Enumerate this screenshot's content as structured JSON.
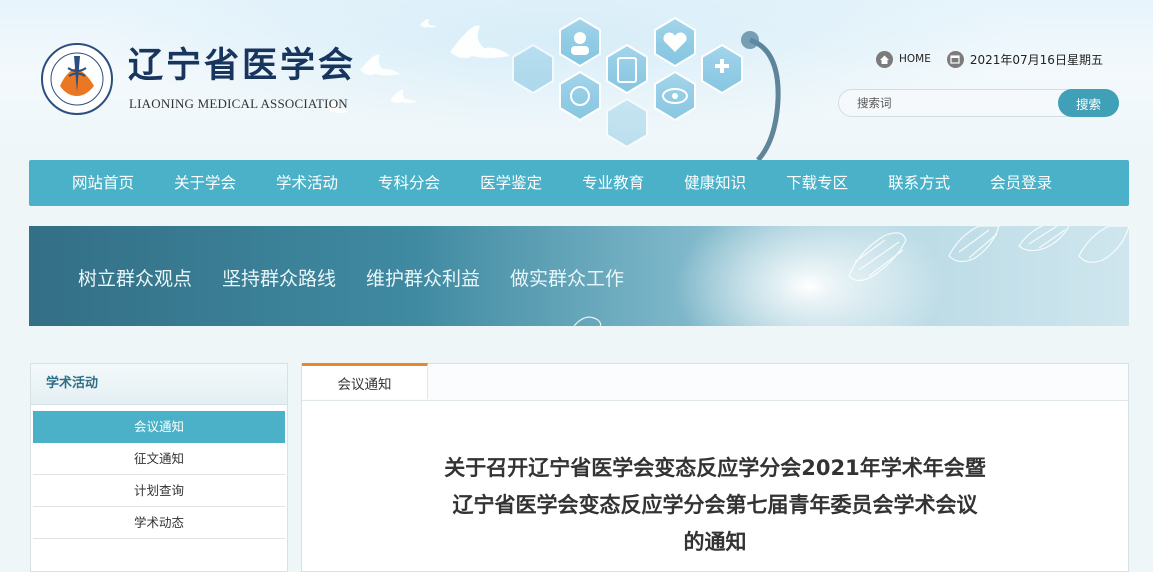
{
  "header": {
    "logo_cn": "辽宁省医学会",
    "logo_en": "LIAONING MEDICAL ASSOCIATION",
    "logo_icon": "liaoning-medical-association-seal",
    "home_label": "HOME",
    "home_icon": "home-icon",
    "date_icon": "calendar-icon",
    "date": "2021年07月16日星期五",
    "search": {
      "placeholder": "搜索词",
      "button_label": "搜索"
    }
  },
  "nav": {
    "items": [
      {
        "label": "网站首页"
      },
      {
        "label": "关于学会"
      },
      {
        "label": "学术活动"
      },
      {
        "label": "专科分会"
      },
      {
        "label": "医学鉴定"
      },
      {
        "label": "专业教育"
      },
      {
        "label": "健康知识"
      },
      {
        "label": "下载专区"
      },
      {
        "label": "联系方式"
      },
      {
        "label": "会员登录"
      }
    ]
  },
  "banner": {
    "slogans": [
      "树立群众观点",
      "坚持群众路线",
      "维护群众利益",
      "做实群众工作"
    ]
  },
  "sidebar": {
    "title": "学术活动",
    "items": [
      {
        "label": "会议通知",
        "active": true
      },
      {
        "label": "征文通知",
        "active": false
      },
      {
        "label": "计划查询",
        "active": false
      },
      {
        "label": "学术动态",
        "active": false
      }
    ]
  },
  "main": {
    "tab_label": "会议通知",
    "article_title_lines": [
      "关于召开辽宁省医学会变态反应学分会2021年学术年会暨",
      "辽宁省医学会变态反应学分会第七届青年委员会学术会议",
      "的通知"
    ]
  },
  "colors": {
    "nav_bg": "#4ab1c9",
    "accent": "#e8862a",
    "search_button": "#3fa0b7",
    "logo_text": "#17355d"
  }
}
